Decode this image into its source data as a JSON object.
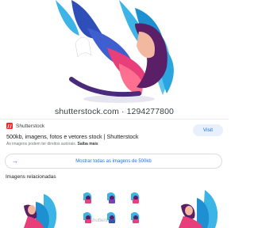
{
  "hero": {
    "caption": "shutterstock.com · 1294277800"
  },
  "result": {
    "source_name": "Shutterstock",
    "visit_label": "Visit",
    "title": "500kb, imagens, fotos e vetores stock | Shutterstock",
    "copyright_text": "As imagens podem ter direitos autorais.",
    "learn_more": "Saiba mais"
  },
  "show_all": {
    "label": "Mostrar todas as imagens de 500kb"
  },
  "related": {
    "heading": "Imagens relacionadas",
    "watermark": "shutterstock"
  },
  "colors": {
    "accent": "#1a73e8",
    "visit_bg": "#e8f0fe",
    "brand_red": "#ee2b24"
  },
  "icons": {
    "source_logo": "shutterstock-logo-icon",
    "arrow": "arrow-right-icon"
  }
}
